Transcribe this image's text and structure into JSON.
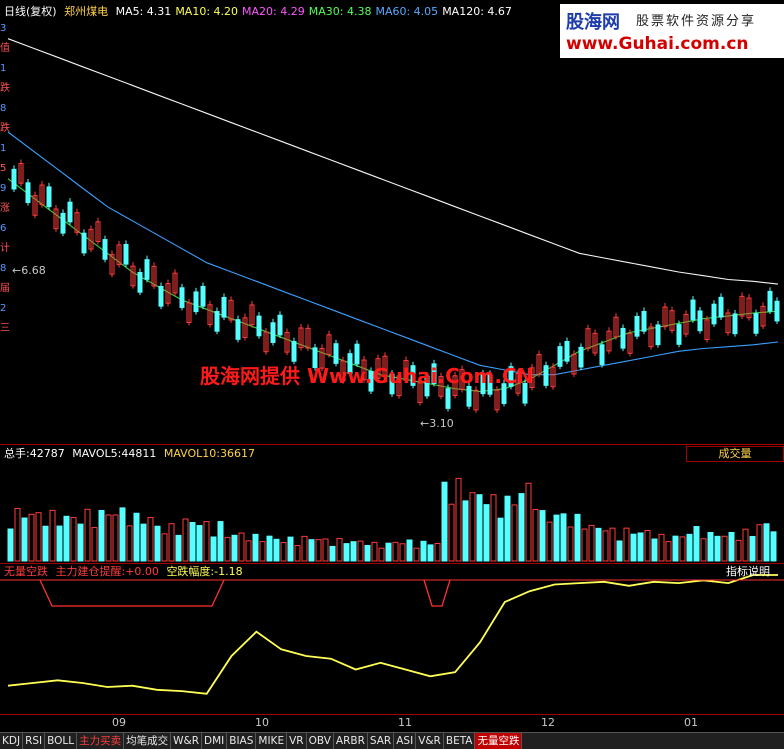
{
  "price_header": {
    "period": "日线(复权)",
    "stock": "郑州煤电",
    "ma": [
      {
        "label": "MA5:",
        "value": "4.31",
        "color": "#ffffff"
      },
      {
        "label": "MA10:",
        "value": "4.20",
        "color": "#ffff55"
      },
      {
        "label": "MA20:",
        "value": "4.29",
        "color": "#ff55ff"
      },
      {
        "label": "MA30:",
        "value": "4.38",
        "color": "#55ff55"
      },
      {
        "label": "MA60:",
        "value": "4.05",
        "color": "#55aaff"
      },
      {
        "label": "MA120:",
        "value": "4.67",
        "color": "#ffffff"
      }
    ]
  },
  "left_axis_chars": [
    "3",
    "值",
    "1",
    "跌",
    "8",
    "跌",
    "1",
    "5",
    "9",
    "涨",
    "6",
    "计",
    "8",
    "届",
    "2",
    "三"
  ],
  "price_labels": {
    "high": "6.68",
    "low": "3.10"
  },
  "logo": {
    "main": "股海网",
    "sub": "股票软件资源分享",
    "url": "www.Guhai.com.cn"
  },
  "watermark": "股海网提供 Www.Guhai.Com.CN",
  "volume_header": {
    "label": "总手:",
    "value": "42787",
    "mavol5_label": "MAVOL5:",
    "mavol5": "44811",
    "mavol10_label": "MAVOL10:",
    "mavol10": "36617",
    "button": "成交量"
  },
  "indicator_header": {
    "name": "无量空跌",
    "sub": "主力建仓提醒:",
    "sub_value": "+0.00",
    "amp_label": "空跌幅度:",
    "amp_value": "-1.18",
    "help": "指标说明"
  },
  "time_axis": [
    "09",
    "10",
    "11",
    "12",
    "01"
  ],
  "tabs": [
    {
      "label": "KDJ",
      "style": "normal"
    },
    {
      "label": "RSI",
      "style": "normal"
    },
    {
      "label": "BOLL",
      "style": "normal"
    },
    {
      "label": "主力买卖",
      "style": "red"
    },
    {
      "label": "均笔成交",
      "style": "normal"
    },
    {
      "label": "W&R",
      "style": "normal"
    },
    {
      "label": "DMI",
      "style": "normal"
    },
    {
      "label": "BIAS",
      "style": "normal"
    },
    {
      "label": "MIKE",
      "style": "normal"
    },
    {
      "label": "VR",
      "style": "normal"
    },
    {
      "label": "OBV",
      "style": "normal"
    },
    {
      "label": "ARBR",
      "style": "normal"
    },
    {
      "label": "SAR",
      "style": "normal"
    },
    {
      "label": "ASI",
      "style": "normal"
    },
    {
      "label": "V&R",
      "style": "normal"
    },
    {
      "label": "BETA",
      "style": "normal"
    },
    {
      "label": "无量空跌",
      "style": "active"
    }
  ],
  "chart_data": {
    "type": "line",
    "price_series_ma": {
      "MA120": [
        7.3,
        7.2,
        7.1,
        7.0,
        6.9,
        6.8,
        6.7,
        6.6,
        6.5,
        6.4,
        6.3,
        6.2,
        6.1,
        6.0,
        5.9,
        5.8,
        5.7,
        5.6,
        5.5,
        5.4,
        5.3,
        5.2,
        5.1,
        5.0,
        4.95,
        4.9,
        4.85,
        4.8,
        4.76,
        4.72,
        4.7,
        4.67
      ],
      "MA60": [
        6.3,
        6.1,
        5.9,
        5.7,
        5.5,
        5.35,
        5.2,
        5.05,
        4.9,
        4.8,
        4.7,
        4.6,
        4.5,
        4.4,
        4.3,
        4.2,
        4.1,
        4.0,
        3.9,
        3.8,
        3.75,
        3.7,
        3.7,
        3.75,
        3.8,
        3.85,
        3.9,
        3.95,
        3.98,
        4.0,
        4.02,
        4.05
      ],
      "MA30": [
        5.8,
        5.6,
        5.4,
        5.2,
        5.0,
        4.8,
        4.65,
        4.5,
        4.4,
        4.3,
        4.2,
        4.1,
        4.0,
        3.9,
        3.8,
        3.7,
        3.65,
        3.6,
        3.55,
        3.52,
        3.55,
        3.65,
        3.8,
        3.95,
        4.05,
        4.15,
        4.2,
        4.25,
        4.3,
        4.33,
        4.36,
        4.38
      ]
    },
    "volume": [
      40,
      38,
      36,
      39,
      41,
      36,
      28,
      33,
      30,
      22,
      20,
      18,
      19,
      17,
      16,
      14,
      16,
      15,
      62,
      55,
      50,
      60,
      38,
      35,
      28,
      25,
      24,
      20,
      26,
      22,
      24,
      30
    ],
    "indicator_kongdie": [
      0.82,
      0.8,
      0.78,
      0.8,
      0.83,
      0.82,
      0.85,
      0.86,
      0.88,
      0.6,
      0.42,
      0.55,
      0.6,
      0.62,
      0.7,
      0.65,
      0.7,
      0.75,
      0.72,
      0.5,
      0.2,
      0.12,
      0.07,
      0.06,
      0.05,
      0.08,
      0.05,
      0.06,
      0.04,
      0.06,
      0.0,
      0.0
    ]
  }
}
